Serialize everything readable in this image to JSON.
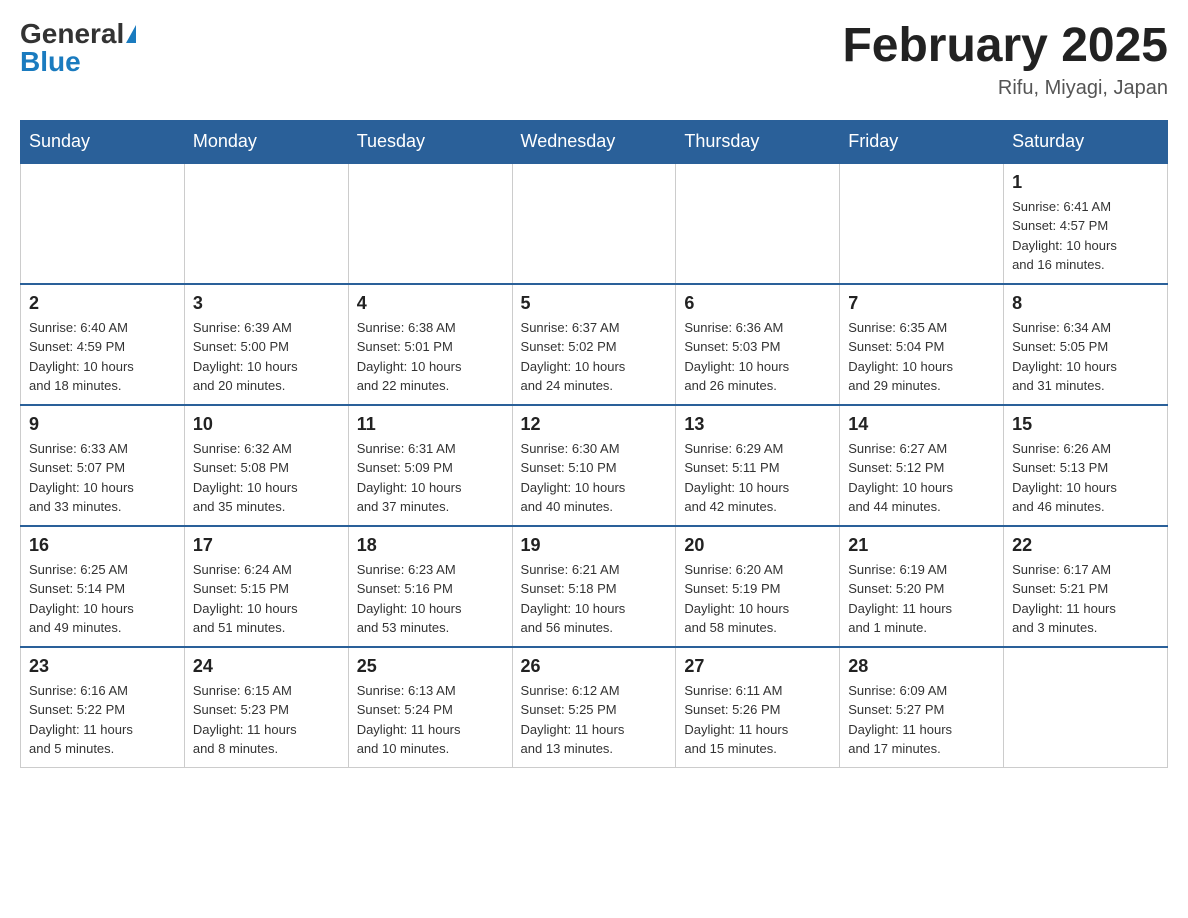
{
  "header": {
    "logo_general": "General",
    "logo_blue": "Blue",
    "month_title": "February 2025",
    "location": "Rifu, Miyagi, Japan"
  },
  "days_of_week": [
    "Sunday",
    "Monday",
    "Tuesday",
    "Wednesday",
    "Thursday",
    "Friday",
    "Saturday"
  ],
  "weeks": [
    [
      {
        "day": "",
        "info": "",
        "empty": true
      },
      {
        "day": "",
        "info": "",
        "empty": true
      },
      {
        "day": "",
        "info": "",
        "empty": true
      },
      {
        "day": "",
        "info": "",
        "empty": true
      },
      {
        "day": "",
        "info": "",
        "empty": true
      },
      {
        "day": "",
        "info": "",
        "empty": true
      },
      {
        "day": "1",
        "info": "Sunrise: 6:41 AM\nSunset: 4:57 PM\nDaylight: 10 hours\nand 16 minutes.",
        "empty": false
      }
    ],
    [
      {
        "day": "2",
        "info": "Sunrise: 6:40 AM\nSunset: 4:59 PM\nDaylight: 10 hours\nand 18 minutes.",
        "empty": false
      },
      {
        "day": "3",
        "info": "Sunrise: 6:39 AM\nSunset: 5:00 PM\nDaylight: 10 hours\nand 20 minutes.",
        "empty": false
      },
      {
        "day": "4",
        "info": "Sunrise: 6:38 AM\nSunset: 5:01 PM\nDaylight: 10 hours\nand 22 minutes.",
        "empty": false
      },
      {
        "day": "5",
        "info": "Sunrise: 6:37 AM\nSunset: 5:02 PM\nDaylight: 10 hours\nand 24 minutes.",
        "empty": false
      },
      {
        "day": "6",
        "info": "Sunrise: 6:36 AM\nSunset: 5:03 PM\nDaylight: 10 hours\nand 26 minutes.",
        "empty": false
      },
      {
        "day": "7",
        "info": "Sunrise: 6:35 AM\nSunset: 5:04 PM\nDaylight: 10 hours\nand 29 minutes.",
        "empty": false
      },
      {
        "day": "8",
        "info": "Sunrise: 6:34 AM\nSunset: 5:05 PM\nDaylight: 10 hours\nand 31 minutes.",
        "empty": false
      }
    ],
    [
      {
        "day": "9",
        "info": "Sunrise: 6:33 AM\nSunset: 5:07 PM\nDaylight: 10 hours\nand 33 minutes.",
        "empty": false
      },
      {
        "day": "10",
        "info": "Sunrise: 6:32 AM\nSunset: 5:08 PM\nDaylight: 10 hours\nand 35 minutes.",
        "empty": false
      },
      {
        "day": "11",
        "info": "Sunrise: 6:31 AM\nSunset: 5:09 PM\nDaylight: 10 hours\nand 37 minutes.",
        "empty": false
      },
      {
        "day": "12",
        "info": "Sunrise: 6:30 AM\nSunset: 5:10 PM\nDaylight: 10 hours\nand 40 minutes.",
        "empty": false
      },
      {
        "day": "13",
        "info": "Sunrise: 6:29 AM\nSunset: 5:11 PM\nDaylight: 10 hours\nand 42 minutes.",
        "empty": false
      },
      {
        "day": "14",
        "info": "Sunrise: 6:27 AM\nSunset: 5:12 PM\nDaylight: 10 hours\nand 44 minutes.",
        "empty": false
      },
      {
        "day": "15",
        "info": "Sunrise: 6:26 AM\nSunset: 5:13 PM\nDaylight: 10 hours\nand 46 minutes.",
        "empty": false
      }
    ],
    [
      {
        "day": "16",
        "info": "Sunrise: 6:25 AM\nSunset: 5:14 PM\nDaylight: 10 hours\nand 49 minutes.",
        "empty": false
      },
      {
        "day": "17",
        "info": "Sunrise: 6:24 AM\nSunset: 5:15 PM\nDaylight: 10 hours\nand 51 minutes.",
        "empty": false
      },
      {
        "day": "18",
        "info": "Sunrise: 6:23 AM\nSunset: 5:16 PM\nDaylight: 10 hours\nand 53 minutes.",
        "empty": false
      },
      {
        "day": "19",
        "info": "Sunrise: 6:21 AM\nSunset: 5:18 PM\nDaylight: 10 hours\nand 56 minutes.",
        "empty": false
      },
      {
        "day": "20",
        "info": "Sunrise: 6:20 AM\nSunset: 5:19 PM\nDaylight: 10 hours\nand 58 minutes.",
        "empty": false
      },
      {
        "day": "21",
        "info": "Sunrise: 6:19 AM\nSunset: 5:20 PM\nDaylight: 11 hours\nand 1 minute.",
        "empty": false
      },
      {
        "day": "22",
        "info": "Sunrise: 6:17 AM\nSunset: 5:21 PM\nDaylight: 11 hours\nand 3 minutes.",
        "empty": false
      }
    ],
    [
      {
        "day": "23",
        "info": "Sunrise: 6:16 AM\nSunset: 5:22 PM\nDaylight: 11 hours\nand 5 minutes.",
        "empty": false
      },
      {
        "day": "24",
        "info": "Sunrise: 6:15 AM\nSunset: 5:23 PM\nDaylight: 11 hours\nand 8 minutes.",
        "empty": false
      },
      {
        "day": "25",
        "info": "Sunrise: 6:13 AM\nSunset: 5:24 PM\nDaylight: 11 hours\nand 10 minutes.",
        "empty": false
      },
      {
        "day": "26",
        "info": "Sunrise: 6:12 AM\nSunset: 5:25 PM\nDaylight: 11 hours\nand 13 minutes.",
        "empty": false
      },
      {
        "day": "27",
        "info": "Sunrise: 6:11 AM\nSunset: 5:26 PM\nDaylight: 11 hours\nand 15 minutes.",
        "empty": false
      },
      {
        "day": "28",
        "info": "Sunrise: 6:09 AM\nSunset: 5:27 PM\nDaylight: 11 hours\nand 17 minutes.",
        "empty": false
      },
      {
        "day": "",
        "info": "",
        "empty": true
      }
    ]
  ]
}
